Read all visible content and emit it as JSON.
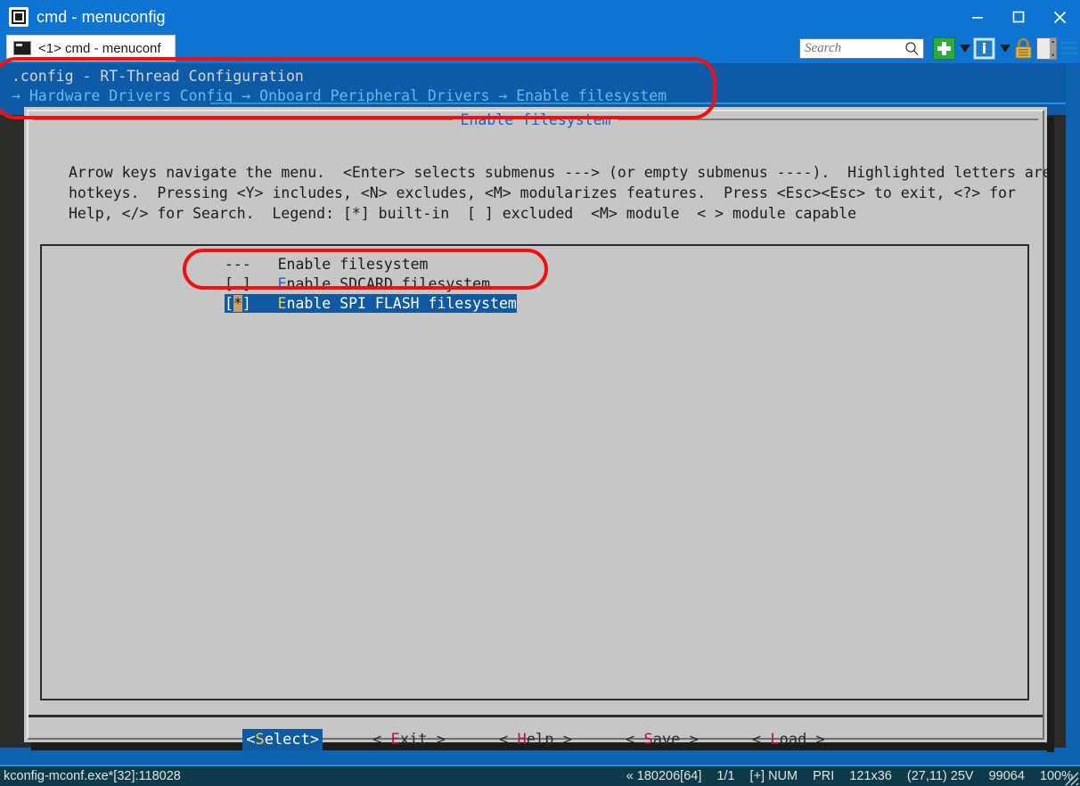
{
  "window": {
    "title": "cmd - menuconfig",
    "app_icon": "terminal-icon",
    "minimize_label": "Minimize",
    "maximize_label": "Maximize",
    "close_label": "Close"
  },
  "tabbar": {
    "tab_label": "<1> cmd - menuconf",
    "tab_icon": "console-icon"
  },
  "toolbar": {
    "search_placeholder": "Search",
    "search_value": "",
    "new_tab_label": "New tab",
    "new_tab_caret_label": "New tab options",
    "info_label": "Window info",
    "info_caret_label": "Window options",
    "lock_label": "Lock",
    "panel_label": "Toggle panel",
    "menu_label": "Menu"
  },
  "menuconfig": {
    "header_line1": ".config - RT-Thread Configuration",
    "header_line2": "→ Hardware Drivers Config → Onboard Peripheral Drivers → Enable filesystem",
    "dialog_title": "Enable filesystem",
    "help_text": "Arrow keys navigate the menu.  <Enter> selects submenus ---> (or empty submenus ----).  Highlighted letters are hotkeys.  Pressing <Y> includes, <N> excludes, <M> modularizes features.  Press <Esc><Esc> to exit, <?> for Help, </> for Search.  Legend: [*] built-in  [ ] excluded  <M> module  < > module capable",
    "items": [
      {
        "type": "separator",
        "prefix": "---",
        "label": "Enable filesystem",
        "selected": false
      },
      {
        "type": "checkbox",
        "state": "[ ]",
        "hotkey": "E",
        "label_rest": "nable SDCARD filesystem",
        "label_full": "Enable SDCARD filesystem",
        "selected": false
      },
      {
        "type": "checkbox",
        "state": "[*]",
        "hotkey": "E",
        "label_rest": "nable SPI FLASH filesystem",
        "label_full": "Enable SPI FLASH filesystem",
        "selected": true
      }
    ],
    "buttons": [
      {
        "text": "<Select>",
        "hotkey": "S",
        "before": "<",
        "after": "elect>",
        "active": true
      },
      {
        "text": "< Exit >",
        "hotkey": "E",
        "before": "< ",
        "after": "xit >",
        "active": false
      },
      {
        "text": "< Help >",
        "hotkey": "H",
        "before": "< ",
        "after": "elp >",
        "active": false
      },
      {
        "text": "< Save >",
        "hotkey": "S",
        "before": "< ",
        "after": "ave >",
        "active": false
      },
      {
        "text": "< Load >",
        "hotkey": "L",
        "before": "< ",
        "after": "oad >",
        "active": false
      }
    ]
  },
  "statusbar": {
    "left": "kconfig-mconf.exe*[32]:118028",
    "items": [
      "« 180206[64]",
      "1/1",
      "[+] NUM",
      "PRI",
      "121x36",
      "(27,11) 25V",
      "99064",
      "100%"
    ]
  },
  "annotations": {
    "header_box": "red-highlight-box-header",
    "row_box": "red-highlight-box-selected-row"
  },
  "colors": {
    "titlebar": "#0d75d1",
    "console_bg": "#2b2b27",
    "menuconfig_header": "#0d5aa7",
    "dialog_bg": "#c6c6c6",
    "selection": "#0f5aa0",
    "cursor": "#c8a06a",
    "hotkey_blue": "#1565c0",
    "hotkey_red": "#b4143c",
    "hotkey_yellow": "#e8d44a",
    "annotation_red": "#ef1111",
    "statusbar": "#0d3b4a"
  }
}
